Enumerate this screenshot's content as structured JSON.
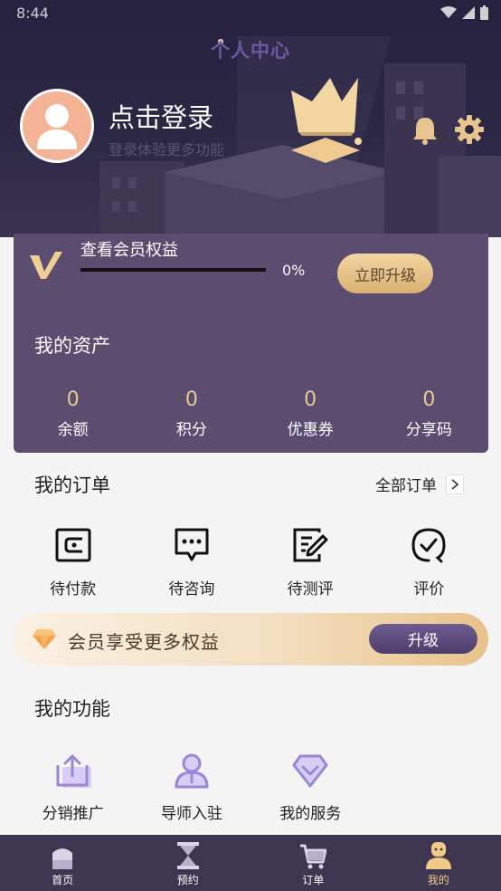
{
  "status_bar": {
    "time": "8:44"
  },
  "header": {
    "page_title": "个人中心",
    "login_title": "点击登录",
    "login_subtitle": "登录体验更多功能"
  },
  "vip": {
    "benefit_label": "查看会员权益",
    "progress_text": "0%",
    "progress_fraction": 0,
    "upgrade_label": "立即升级"
  },
  "assets": {
    "title": "我的资产",
    "items": [
      {
        "value": "0",
        "label": "余额"
      },
      {
        "value": "0",
        "label": "积分"
      },
      {
        "value": "0",
        "label": "优惠券"
      },
      {
        "value": "0",
        "label": "分享码"
      }
    ]
  },
  "orders": {
    "title": "我的订单",
    "all_label": "全部订单",
    "items": [
      {
        "icon": "wallet-icon",
        "label": "待付款"
      },
      {
        "icon": "chat-icon",
        "label": "待咨询"
      },
      {
        "icon": "edit-icon",
        "label": "待测评"
      },
      {
        "icon": "check-circle-icon",
        "label": "评价"
      }
    ]
  },
  "member_banner": {
    "text": "会员享受更多权益",
    "button_label": "升级"
  },
  "functions": {
    "title": "我的功能",
    "items": [
      {
        "icon": "share-icon",
        "label": "分销推广"
      },
      {
        "icon": "mentor-icon",
        "label": "导师入驻"
      },
      {
        "icon": "diamond-service-icon",
        "label": "我的服务"
      }
    ]
  },
  "nav": {
    "items": [
      {
        "icon": "home-icon",
        "label": "首页"
      },
      {
        "icon": "hourglass-icon",
        "label": "预约"
      },
      {
        "icon": "cart-icon",
        "label": "订单"
      },
      {
        "icon": "profile-icon",
        "label": "我的"
      }
    ],
    "active_index": 3
  },
  "colors": {
    "header_bg": "#25213f",
    "card_bg": "#5a4d70",
    "gold": "#e8c58f",
    "nav_bg": "#3e3550",
    "purple_icon": "#9b86d8"
  }
}
